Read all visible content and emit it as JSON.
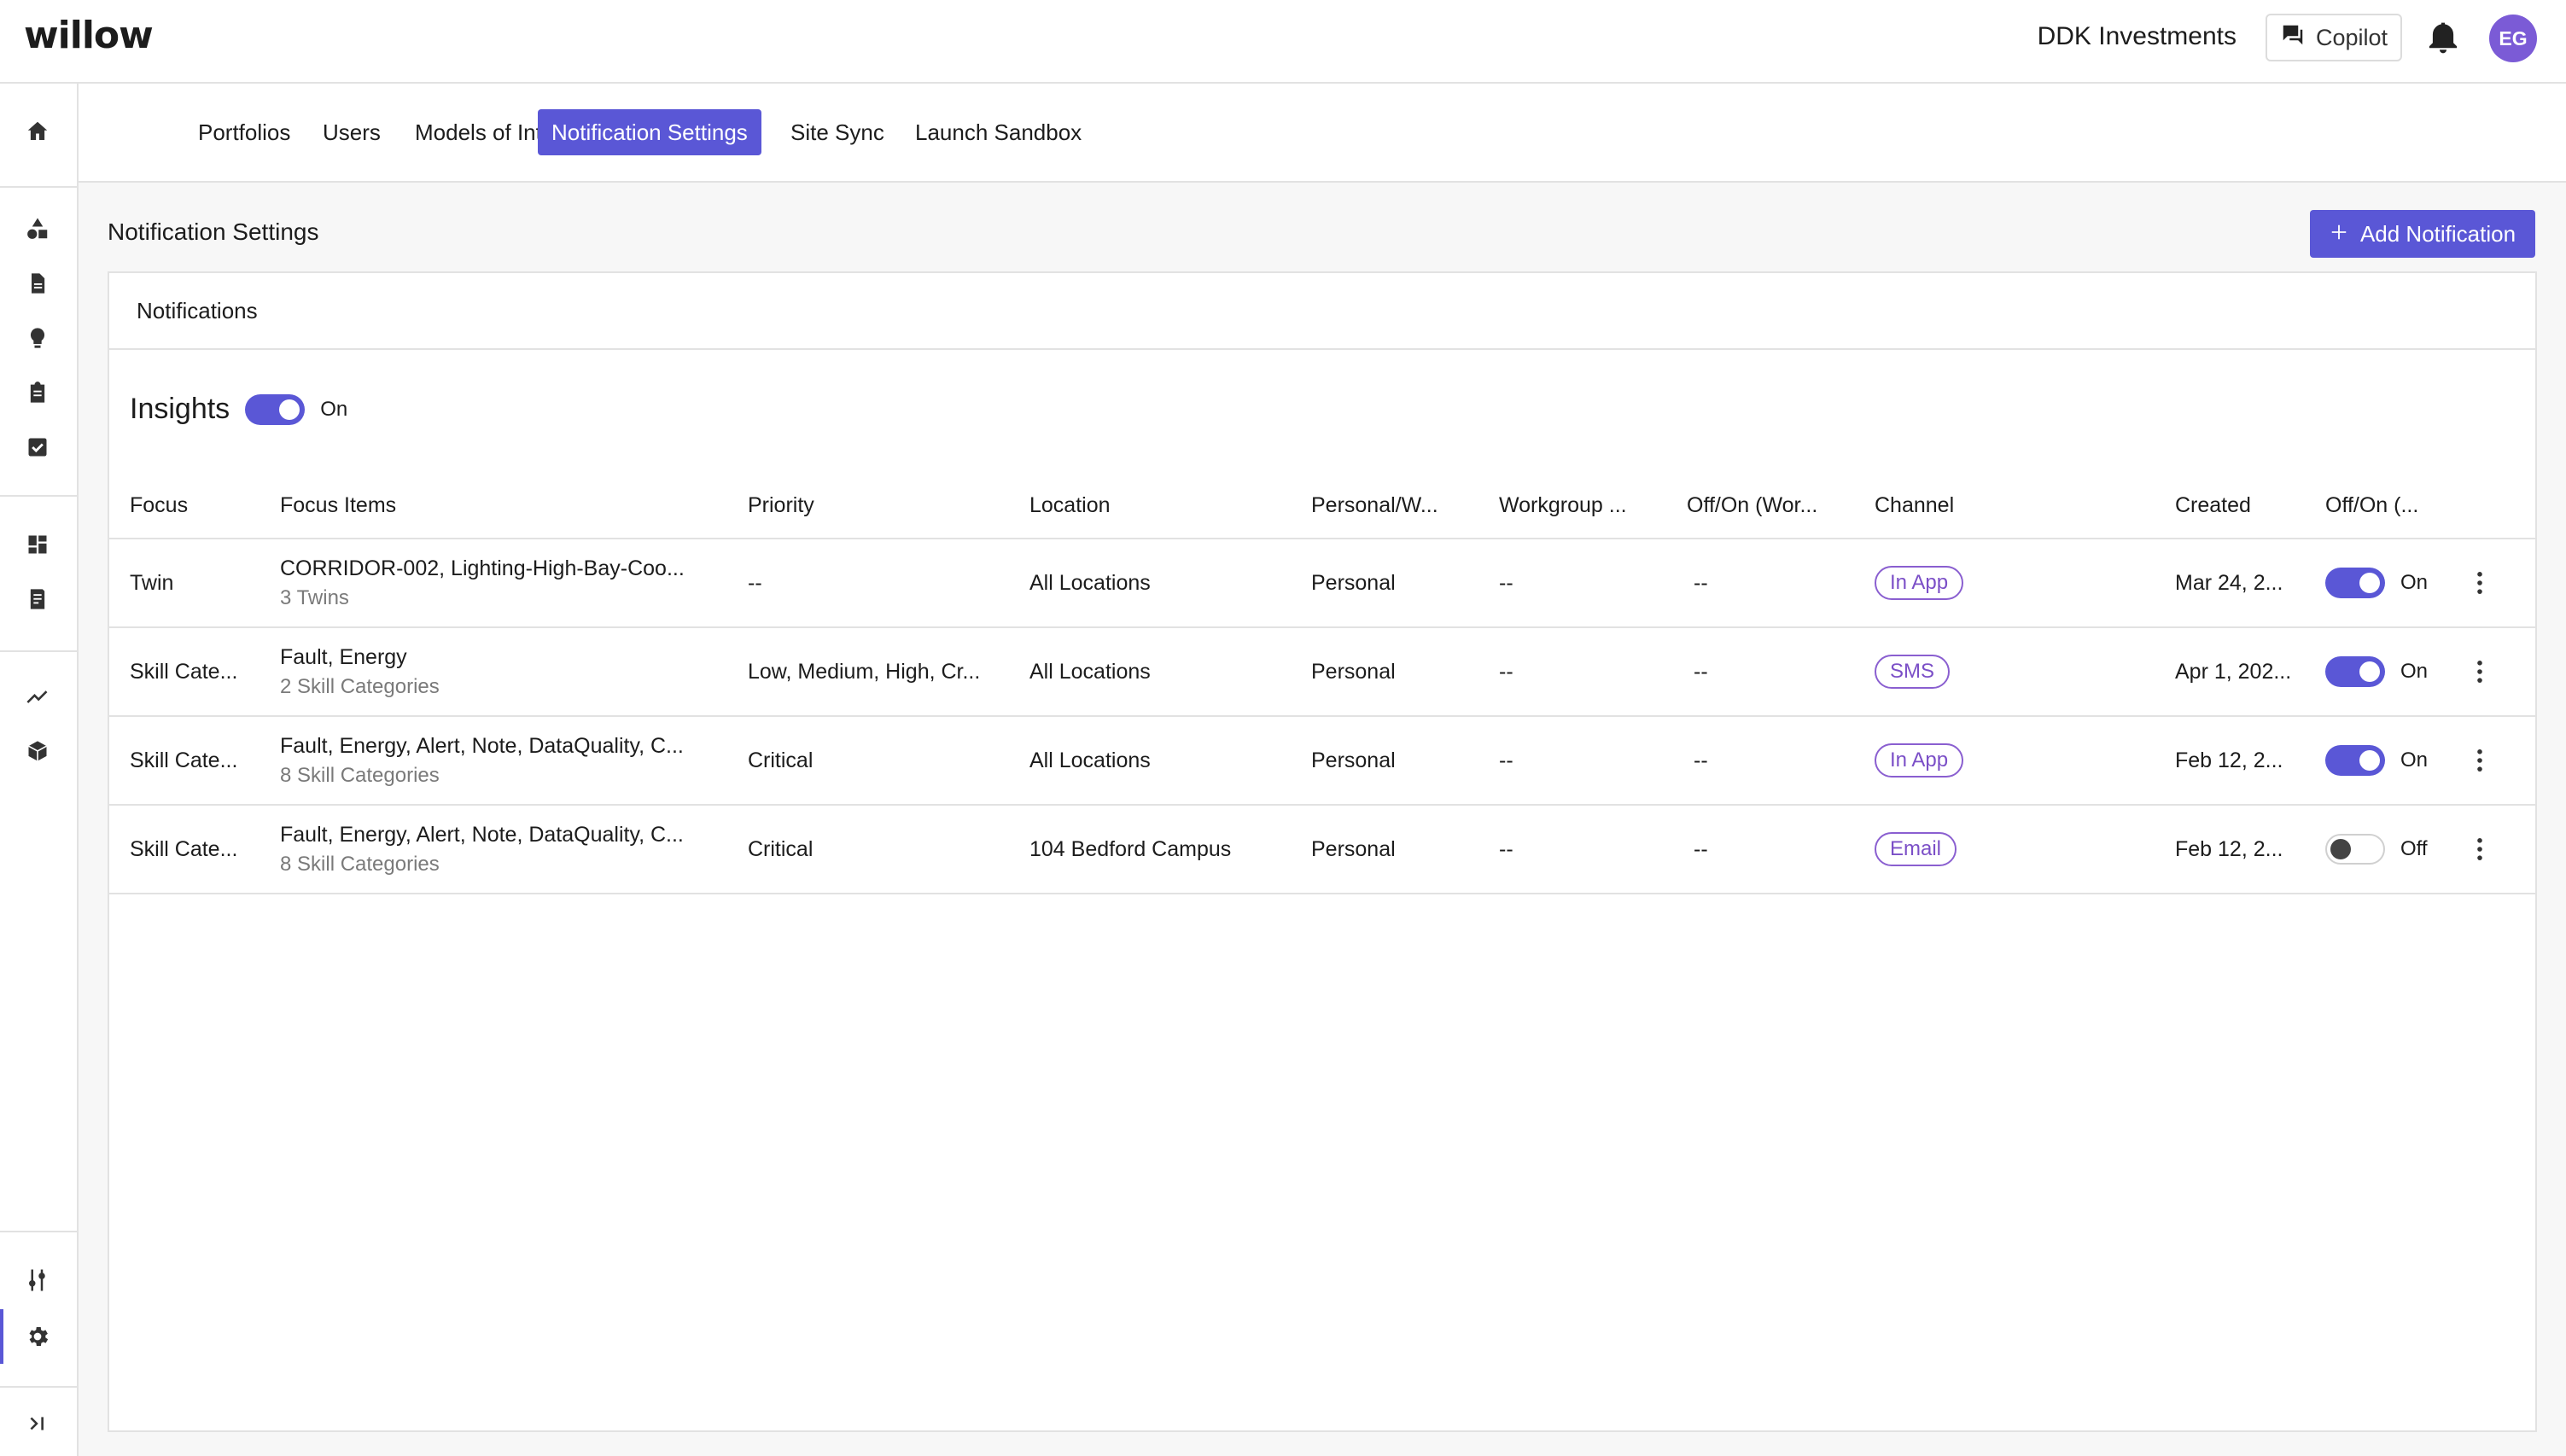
{
  "header": {
    "logo": "willow",
    "org_name": "DDK Investments",
    "copilot_label": "Copilot",
    "avatar_initials": "EG",
    "accent_color": "#5a57d6",
    "avatar_color": "#7b5bd6"
  },
  "sidebar": {
    "items": [
      {
        "name": "home-icon"
      },
      {
        "name": "shapes-icon"
      },
      {
        "name": "document-icon"
      },
      {
        "name": "lightbulb-icon"
      },
      {
        "name": "clipboard-icon"
      },
      {
        "name": "checkbox-icon"
      },
      {
        "name": "dashboard-icon"
      },
      {
        "name": "report-icon"
      },
      {
        "name": "trend-icon"
      },
      {
        "name": "cube-icon"
      },
      {
        "name": "sliders-icon"
      },
      {
        "name": "gear-icon"
      },
      {
        "name": "expand-icon"
      }
    ]
  },
  "tabs": [
    {
      "label": "Portfolios"
    },
    {
      "label": "Users"
    },
    {
      "label": "Models of Interest"
    },
    {
      "label": "Notification Settings",
      "active": true
    },
    {
      "label": "Site Sync"
    },
    {
      "label": "Launch Sandbox"
    }
  ],
  "page": {
    "title": "Notification Settings",
    "add_button": "Add Notification"
  },
  "panel": {
    "title": "Notifications",
    "insights": {
      "title": "Insights",
      "state": "On"
    }
  },
  "table": {
    "columns": [
      "Focus",
      "Focus Items",
      "Priority",
      "Location",
      "Personal/W...",
      "Workgroup ...",
      "Off/On (Wor...",
      "Channel",
      "Created",
      "Off/On (..."
    ],
    "rows": [
      {
        "focus": "Twin",
        "focus_items": "CORRIDOR-002, Lighting-High-Bay-Coo...",
        "focus_items_sub": "3 Twins",
        "priority": "--",
        "location": "All Locations",
        "personal": "Personal",
        "workgroup": "--",
        "offon_wg": "--",
        "channel": "In App",
        "created": "Mar 24, 2...",
        "state": "On"
      },
      {
        "focus": "Skill Cate...",
        "focus_items": "Fault, Energy",
        "focus_items_sub": "2 Skill Categories",
        "priority": "Low, Medium, High, Cr...",
        "location": "All Locations",
        "personal": "Personal",
        "workgroup": "--",
        "offon_wg": "--",
        "channel": "SMS",
        "created": "Apr 1, 202...",
        "state": "On"
      },
      {
        "focus": "Skill Cate...",
        "focus_items": "Fault, Energy, Alert, Note, DataQuality, C...",
        "focus_items_sub": "8 Skill Categories",
        "priority": "Critical",
        "location": "All Locations",
        "personal": "Personal",
        "workgroup": "--",
        "offon_wg": "--",
        "channel": "In App",
        "created": "Feb 12, 2...",
        "state": "On"
      },
      {
        "focus": "Skill Cate...",
        "focus_items": "Fault, Energy, Alert, Note, DataQuality, C...",
        "focus_items_sub": "8 Skill Categories",
        "priority": "Critical",
        "location": "104 Bedford Campus",
        "personal": "Personal",
        "workgroup": "--",
        "offon_wg": "--",
        "channel": "Email",
        "created": "Feb 12, 2...",
        "state": "Off"
      }
    ]
  }
}
